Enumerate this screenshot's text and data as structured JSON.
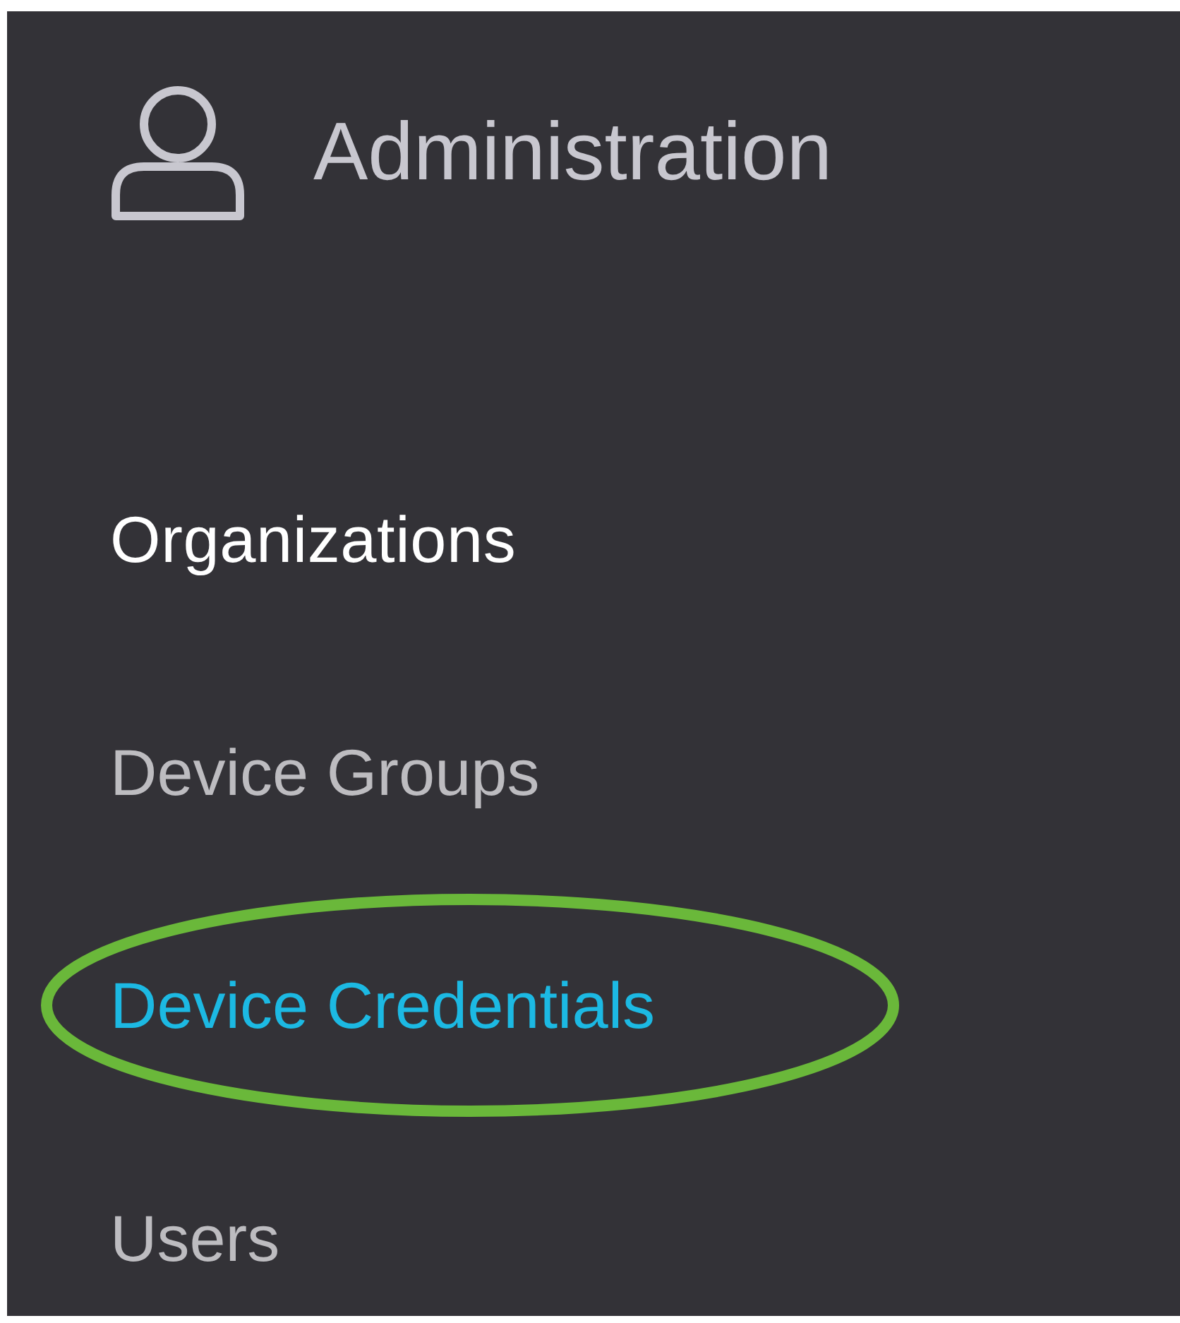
{
  "header": {
    "title": "Administration"
  },
  "menu": [
    {
      "label": "Organizations",
      "kind": "section",
      "selected": false,
      "circled": false
    },
    {
      "label": "Device Groups",
      "kind": "link",
      "selected": false,
      "circled": false
    },
    {
      "label": "Device Credentials",
      "kind": "link",
      "selected": true,
      "circled": true
    },
    {
      "label": "Users",
      "kind": "link",
      "selected": false,
      "circled": false
    }
  ]
}
